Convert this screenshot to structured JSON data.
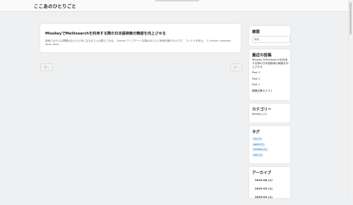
{
  "header": {
    "site_title": "ここあのひとりごと"
  },
  "main": {
    "post": {
      "title": "MisskeyでMeilisearchを利用する際の日本語検索の精度を向上させる",
      "excerpt": "検索ではそんな問題はないけど気になるので入れ替えてみる。 Docker アップデート手順はほとんど参考記事のものです。 コンテナを停止。 ＄ docker compose down dock..."
    },
    "pager": {
      "prev_label": "前へ",
      "next_label": "次へ"
    }
  },
  "sidebar": {
    "search": {
      "title": "検索",
      "placeholder": "検索"
    },
    "recent": {
      "title": "最近の投稿",
      "items": [
        "MisskeyでMeilisearchを利用する際の日本語検索の精度を向上させる",
        "Post 3",
        "Post 2",
        "Post 1",
        "関連記事のテスト"
      ]
    },
    "categories": {
      "title": "カテゴリー",
      "items": [
        "Misskey (1)"
      ]
    },
    "tags": {
      "title": "タグ",
      "items": [
        "css (1)",
        "game (1)",
        "misskey (1)",
        "test (1)"
      ]
    },
    "archive": {
      "title": "アーカイブ",
      "items": [
        "2024-08 (1)",
        "2023-03 (1)",
        "2023-02 (1)"
      ]
    }
  }
}
